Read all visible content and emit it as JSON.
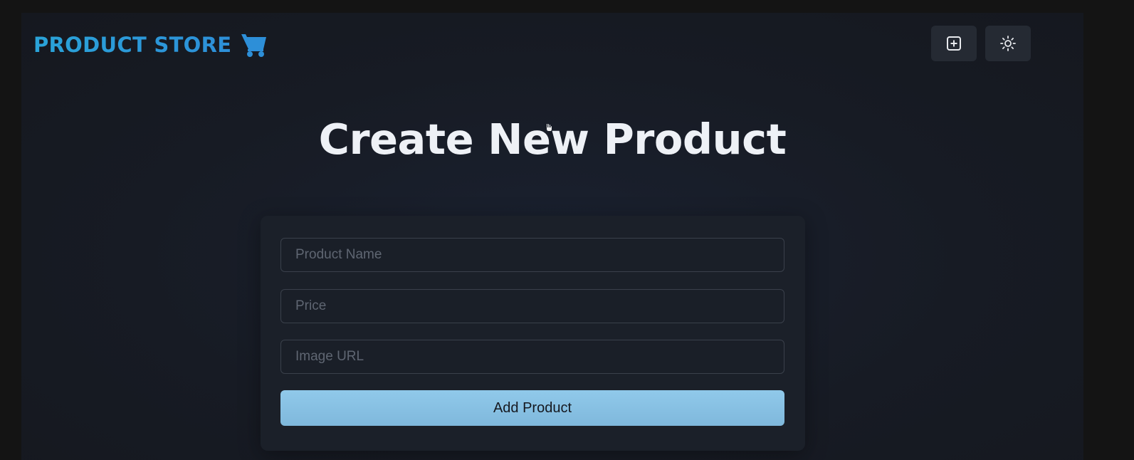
{
  "navbar": {
    "brand": "PRODUCT STORE",
    "brand_icon": "shopping-cart-icon",
    "create_button_icon": "plus-square-icon",
    "theme_button_icon": "sun-icon"
  },
  "main": {
    "title": "Create New Product"
  },
  "form": {
    "name_placeholder": "Product Name",
    "name_value": "",
    "price_placeholder": "Price",
    "price_value": "",
    "image_placeholder": "Image URL",
    "image_value": "",
    "submit_label": "Add Product"
  },
  "colors": {
    "brand": "#2aa3d8",
    "accent_button": "#90c9ea",
    "background": "#171b24",
    "card": "#1b2029"
  }
}
